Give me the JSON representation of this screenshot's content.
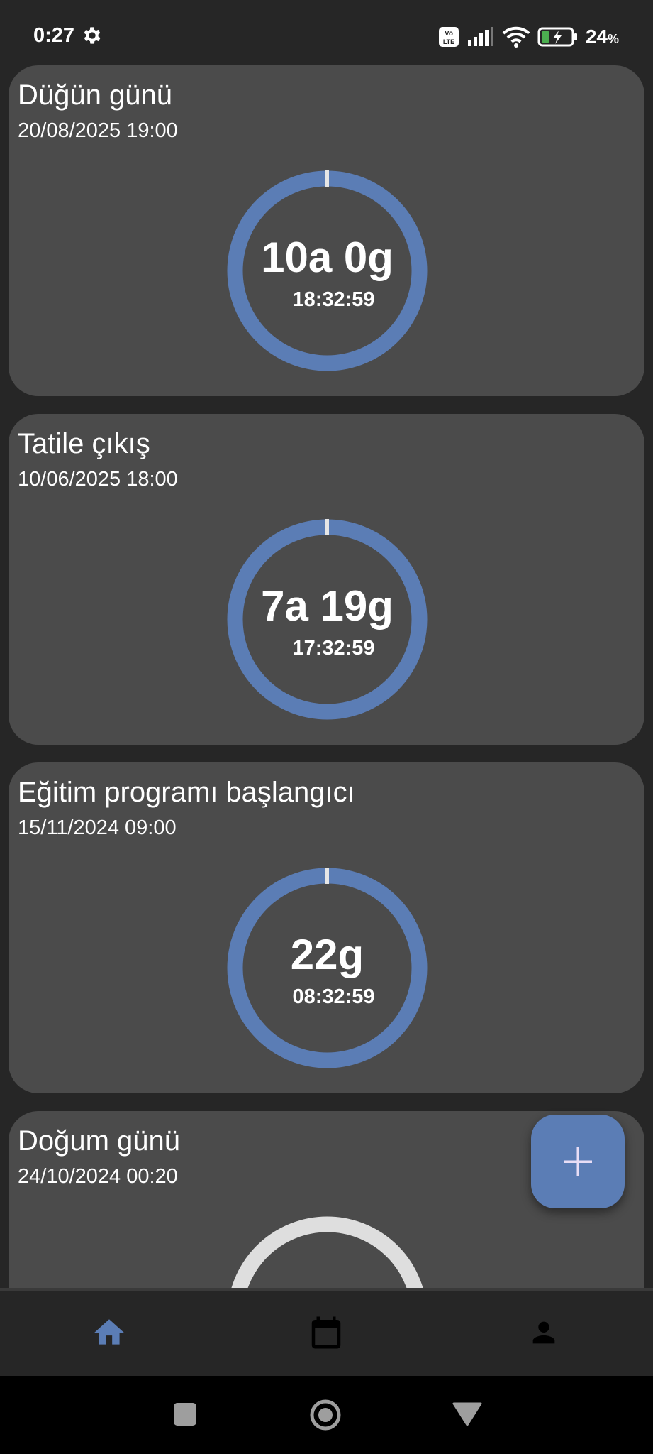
{
  "status_bar": {
    "time": "0:27",
    "battery_percent": "24",
    "battery_unit": "%",
    "icons": [
      "gear-icon",
      "volte-icon",
      "signal-icon",
      "wifi-icon",
      "battery-charging-icon"
    ]
  },
  "events": [
    {
      "title": "Düğün günü",
      "date": "20/08/2025 19:00",
      "countdown": "10a 0g",
      "time": "18:32:59",
      "ring_color": "#5b7db5"
    },
    {
      "title": "Tatile çıkış",
      "date": "10/06/2025 18:00",
      "countdown": "7a 19g",
      "time": "17:32:59",
      "ring_color": "#5b7db5"
    },
    {
      "title": "Eğitim programı başlangıcı",
      "date": "15/11/2024 09:00",
      "countdown": "22g",
      "time": "08:32:59",
      "ring_color": "#5b7db5"
    },
    {
      "title": "Doğum günü",
      "date": "24/10/2024 00:20",
      "countdown": "",
      "time": "",
      "ring_color": "#dedede"
    }
  ],
  "fab": {
    "icon": "plus-icon",
    "color": "#5b7db5"
  },
  "bottom_nav": {
    "items": [
      {
        "icon": "home-icon",
        "active": true
      },
      {
        "icon": "calendar-icon",
        "active": false
      },
      {
        "icon": "person-icon",
        "active": false
      }
    ],
    "active_color": "#5b7db5"
  },
  "system_nav": {
    "icons": [
      "square-icon",
      "circle-icon",
      "back-triangle-icon"
    ]
  }
}
